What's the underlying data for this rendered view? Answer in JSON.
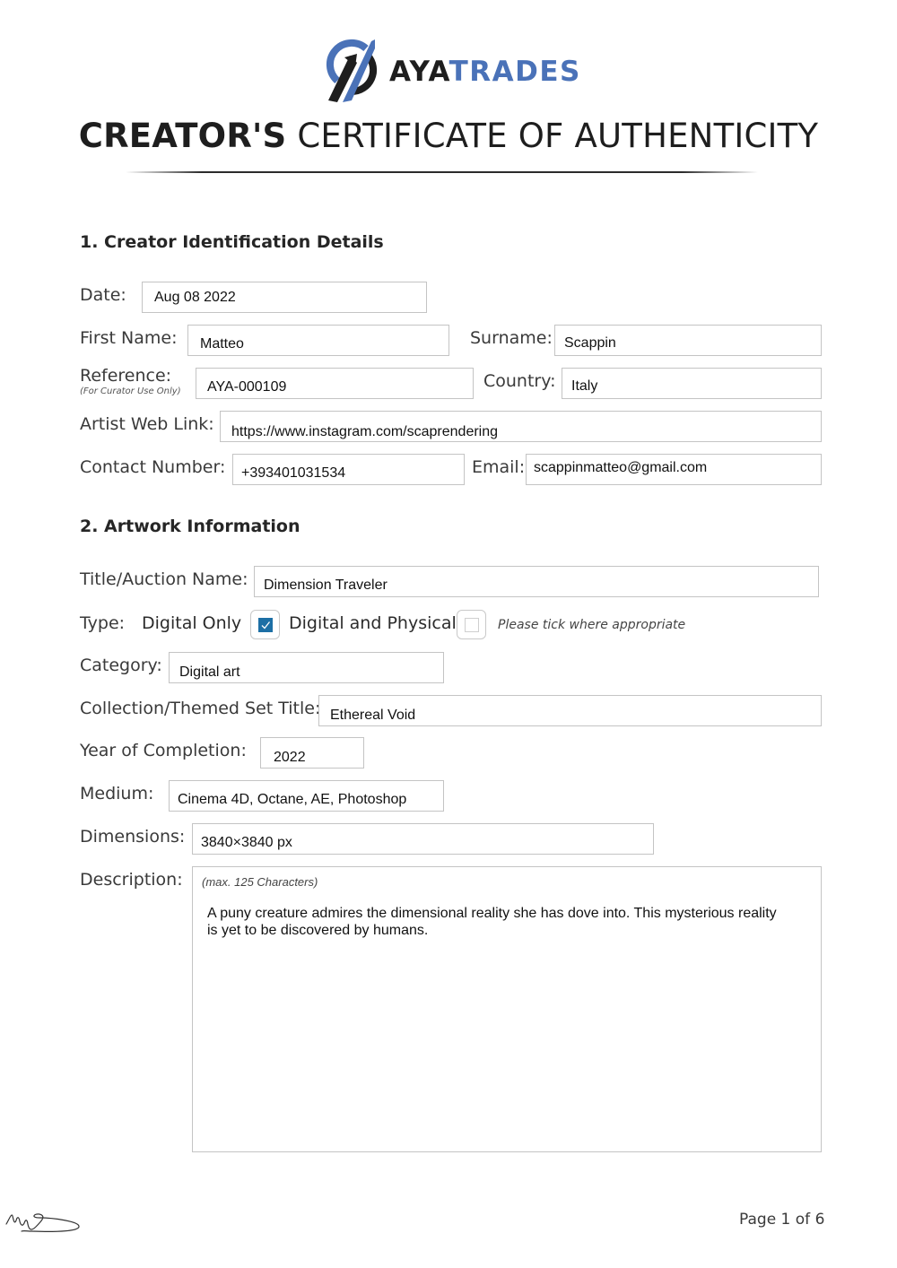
{
  "brand": {
    "name_part1": "AYA",
    "name_part2": "TRADES",
    "logo_icon": "ayatrades-logo-icon",
    "colors": {
      "blue": "#4a72b8",
      "dark": "#1e1e1e",
      "checkbox": "#1d6fa5"
    }
  },
  "title": {
    "bold": "CREATOR'S",
    "light": "CERTIFICATE OF AUTHENTICITY"
  },
  "section1": {
    "heading": "1. Creator Identification Details",
    "date": {
      "label": "Date:",
      "value": "Aug 08 2022"
    },
    "first_name": {
      "label": "First Name:",
      "value": "Matteo"
    },
    "surname": {
      "label": "Surname:",
      "value": "Scappin"
    },
    "reference": {
      "label": "Reference:",
      "sub_label": "(For Curator Use Only)",
      "value": "AYA-000109"
    },
    "country": {
      "label": "Country:",
      "value": "Italy"
    },
    "web_link": {
      "label": "Artist Web Link:",
      "value": "https://www.instagram.com/scaprendering"
    },
    "contact_number": {
      "label": "Contact Number:",
      "value": "+393401031534"
    },
    "email": {
      "label": "Email:",
      "value": "scappinmatteo@gmail.com"
    }
  },
  "section2": {
    "heading": "2. Artwork Information",
    "title_auction": {
      "label": "Title/Auction Name:",
      "value": "Dimension Traveler"
    },
    "type": {
      "label": "Type:",
      "options": [
        {
          "label": "Digital Only",
          "checked": true
        },
        {
          "label": "Digital and Physical",
          "checked": false
        }
      ],
      "hint": "Please tick where appropriate"
    },
    "category": {
      "label": "Category:",
      "value": "Digital art"
    },
    "collection": {
      "label": "Collection/Themed Set Title:",
      "value": "Ethereal Void"
    },
    "year": {
      "label": "Year of Completion:",
      "value": "2022"
    },
    "medium": {
      "label": "Medium:",
      "value": "Cinema 4D, Octane, AE, Photoshop"
    },
    "dimensions": {
      "label": "Dimensions:",
      "value": "3840×3840 px"
    },
    "description": {
      "label": "Description:",
      "hint": "(max. 125 Characters)",
      "value": "A puny creature admires the dimensional reality she has dove into. This mysterious reality is yet to be discovered by humans."
    }
  },
  "footer": {
    "signature_icon": "signature-icon",
    "page_label": "Page 1 of 6",
    "current_page": 1,
    "total_pages": 6
  }
}
